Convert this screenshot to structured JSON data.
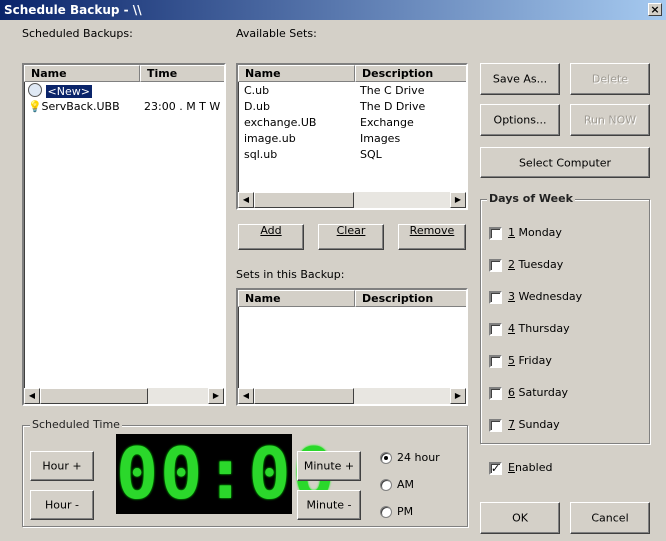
{
  "window": {
    "title": "Schedule Backup - \\\\",
    "close": "×"
  },
  "scheduled_backups": {
    "label": "Scheduled Backups:",
    "columns": [
      "Name",
      "Time"
    ],
    "rows": [
      {
        "name": "<New>",
        "time": "",
        "icon": "clock-icon"
      },
      {
        "name": "ServBack.UBB",
        "time": "23:00 . M T W",
        "icon": "lightbulb-icon"
      }
    ]
  },
  "available_sets": {
    "label": "Available Sets:",
    "columns": [
      "Name",
      "Description"
    ],
    "rows": [
      {
        "name": "C.ub",
        "description": "The C Drive"
      },
      {
        "name": "D.ub",
        "description": "The D Drive"
      },
      {
        "name": "exchange.UB",
        "description": "Exchange"
      },
      {
        "name": "image.ub",
        "description": "Images"
      },
      {
        "name": "sql.ub",
        "description": "SQL"
      }
    ]
  },
  "set_buttons": {
    "add": "Add",
    "clear": "Clear",
    "remove": "Remove"
  },
  "sets_in_backup": {
    "label": "Sets in this Backup:",
    "columns": [
      "Name",
      "Description"
    ]
  },
  "right_buttons": {
    "save_as": "Save As...",
    "delete": "Delete",
    "options": "Options...",
    "run_now": "Run NOW",
    "select_computer": "Select Computer"
  },
  "days_of_week": {
    "title": "Days of Week",
    "days": [
      {
        "num": "1",
        "name": " Monday",
        "checked": false
      },
      {
        "num": "2",
        "name": " Tuesday",
        "checked": false
      },
      {
        "num": "3",
        "name": " Wednesday",
        "checked": false
      },
      {
        "num": "4",
        "name": " Thursday",
        "checked": false
      },
      {
        "num": "5",
        "name": " Friday",
        "checked": false
      },
      {
        "num": "6",
        "name": " Saturday",
        "checked": false
      },
      {
        "num": "7",
        "name": " Sunday",
        "checked": false
      }
    ]
  },
  "enabled": {
    "label_first": "E",
    "label_rest": "nabled",
    "checked": true
  },
  "scheduled_time": {
    "title": "Scheduled Time",
    "clock": "00:00",
    "hour_plus": "Hour +",
    "hour_minus": "Hour -",
    "minute_plus": "Minute +",
    "minute_minus": "Minute -",
    "modes": [
      {
        "label": "24 hour",
        "selected": true
      },
      {
        "label": "AM",
        "selected": false
      },
      {
        "label": "PM",
        "selected": false
      }
    ]
  },
  "dialog_buttons": {
    "ok": "OK",
    "cancel": "Cancel"
  },
  "colors": {
    "clock_digits": "#2bd82b",
    "title_bar": "#0a246a",
    "selection": "#0a246a"
  }
}
